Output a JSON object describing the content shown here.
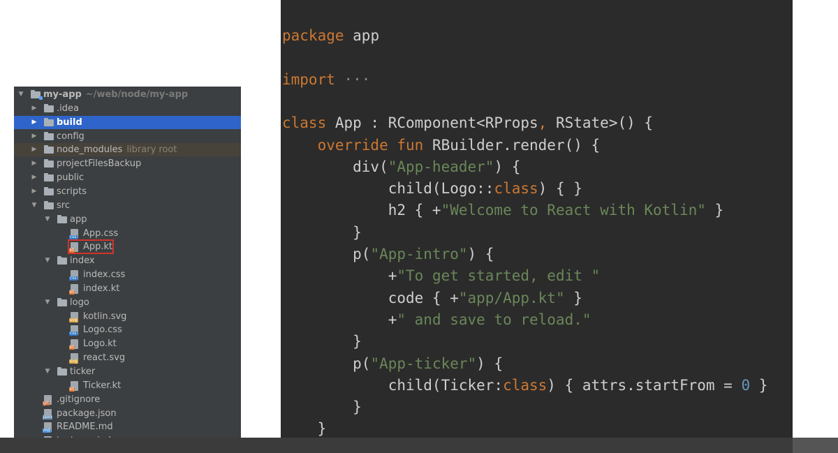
{
  "project_tree": {
    "items": [
      {
        "label": "my-app",
        "hint": "~/web/node/my-app",
        "type": "module",
        "arrow": "▼",
        "depth": 0,
        "bold": true
      },
      {
        "label": ".idea",
        "type": "folder",
        "arrow": "▶",
        "depth": 1
      },
      {
        "label": "build",
        "type": "folder",
        "arrow": "▶",
        "depth": 1,
        "bold": true,
        "selected": true
      },
      {
        "label": "config",
        "type": "folder",
        "arrow": "▶",
        "depth": 1
      },
      {
        "label": "node_modules",
        "hint": "library root",
        "type": "folder",
        "arrow": "▶",
        "depth": 1,
        "library": true
      },
      {
        "label": "projectFilesBackup",
        "type": "folder",
        "arrow": "▶",
        "depth": 1
      },
      {
        "label": "public",
        "type": "folder",
        "arrow": "▶",
        "depth": 1
      },
      {
        "label": "scripts",
        "type": "folder",
        "arrow": "▶",
        "depth": 1
      },
      {
        "label": "src",
        "type": "folder",
        "arrow": "▼",
        "depth": 1
      },
      {
        "label": "app",
        "type": "folder",
        "arrow": "▼",
        "depth": 2
      },
      {
        "label": "App.css",
        "type": "file",
        "badge": "css",
        "depth": 3
      },
      {
        "label": "App.kt",
        "type": "file",
        "badge": "kt",
        "depth": 3,
        "highlighted": true
      },
      {
        "label": "index",
        "type": "folder",
        "arrow": "▼",
        "depth": 2
      },
      {
        "label": "index.css",
        "type": "file",
        "badge": "css",
        "depth": 3
      },
      {
        "label": "index.kt",
        "type": "file",
        "badge": "kt",
        "depth": 3
      },
      {
        "label": "logo",
        "type": "folder",
        "arrow": "▼",
        "depth": 2
      },
      {
        "label": "kotlin.svg",
        "type": "file",
        "badge": "svg",
        "depth": 3
      },
      {
        "label": "Logo.css",
        "type": "file",
        "badge": "css",
        "depth": 3
      },
      {
        "label": "Logo.kt",
        "type": "file",
        "badge": "kt",
        "depth": 3
      },
      {
        "label": "react.svg",
        "type": "file",
        "badge": "svg",
        "depth": 3
      },
      {
        "label": "ticker",
        "type": "folder",
        "arrow": "▼",
        "depth": 2
      },
      {
        "label": "Ticker.kt",
        "type": "file",
        "badge": "kt",
        "depth": 3
      },
      {
        "label": ".gitignore",
        "type": "file",
        "badge": "git",
        "depth": 1
      },
      {
        "label": "package.json",
        "type": "file",
        "badge": "json",
        "depth": 1
      },
      {
        "label": "README.md",
        "type": "file",
        "badge": "md",
        "depth": 1
      },
      {
        "label": "test-app.iml",
        "type": "file",
        "badge": "iml",
        "depth": 1
      }
    ]
  },
  "code": {
    "lines": [
      [
        {
          "t": "package",
          "c": "kw"
        },
        {
          "t": " app"
        }
      ],
      [],
      [
        {
          "t": "import",
          "c": "kw"
        },
        {
          "t": " ···",
          "c": "fold"
        }
      ],
      [],
      [
        {
          "t": "class",
          "c": "kw"
        },
        {
          "t": " App : RComponent<RProps"
        },
        {
          "t": ",",
          "c": "kw"
        },
        {
          "t": " RState>() {"
        }
      ],
      [
        {
          "t": "    "
        },
        {
          "t": "override fun",
          "c": "kw"
        },
        {
          "t": " RBuilder.render() {"
        }
      ],
      [
        {
          "t": "        div("
        },
        {
          "t": "\"App-header\"",
          "c": "str"
        },
        {
          "t": ") {"
        }
      ],
      [
        {
          "t": "            child(Logo::"
        },
        {
          "t": "class",
          "c": "kw"
        },
        {
          "t": ") { }"
        }
      ],
      [
        {
          "t": "            h2 { +"
        },
        {
          "t": "\"Welcome to React with Kotlin\"",
          "c": "str"
        },
        {
          "t": " }"
        }
      ],
      [
        {
          "t": "        }"
        }
      ],
      [
        {
          "t": "        p("
        },
        {
          "t": "\"App-intro\"",
          "c": "str"
        },
        {
          "t": ") {"
        }
      ],
      [
        {
          "t": "            +"
        },
        {
          "t": "\"To get started, edit \"",
          "c": "str"
        }
      ],
      [
        {
          "t": "            code { +"
        },
        {
          "t": "\"app/App.kt\"",
          "c": "str"
        },
        {
          "t": " }"
        }
      ],
      [
        {
          "t": "            +"
        },
        {
          "t": "\" and save to reload.\"",
          "c": "str"
        }
      ],
      [
        {
          "t": "        }"
        }
      ],
      [
        {
          "t": "        p("
        },
        {
          "t": "\"App-ticker\"",
          "c": "str"
        },
        {
          "t": ") {"
        }
      ],
      [
        {
          "t": "            child(Ticker:"
        },
        {
          "t": "class",
          "c": "kw"
        },
        {
          "t": ") { attrs.startFrom = "
        },
        {
          "t": "0",
          "c": "num"
        },
        {
          "t": " }"
        }
      ],
      [
        {
          "t": "        }"
        }
      ],
      [
        {
          "t": "    }"
        }
      ],
      [
        {
          "t": "}"
        }
      ]
    ]
  }
}
